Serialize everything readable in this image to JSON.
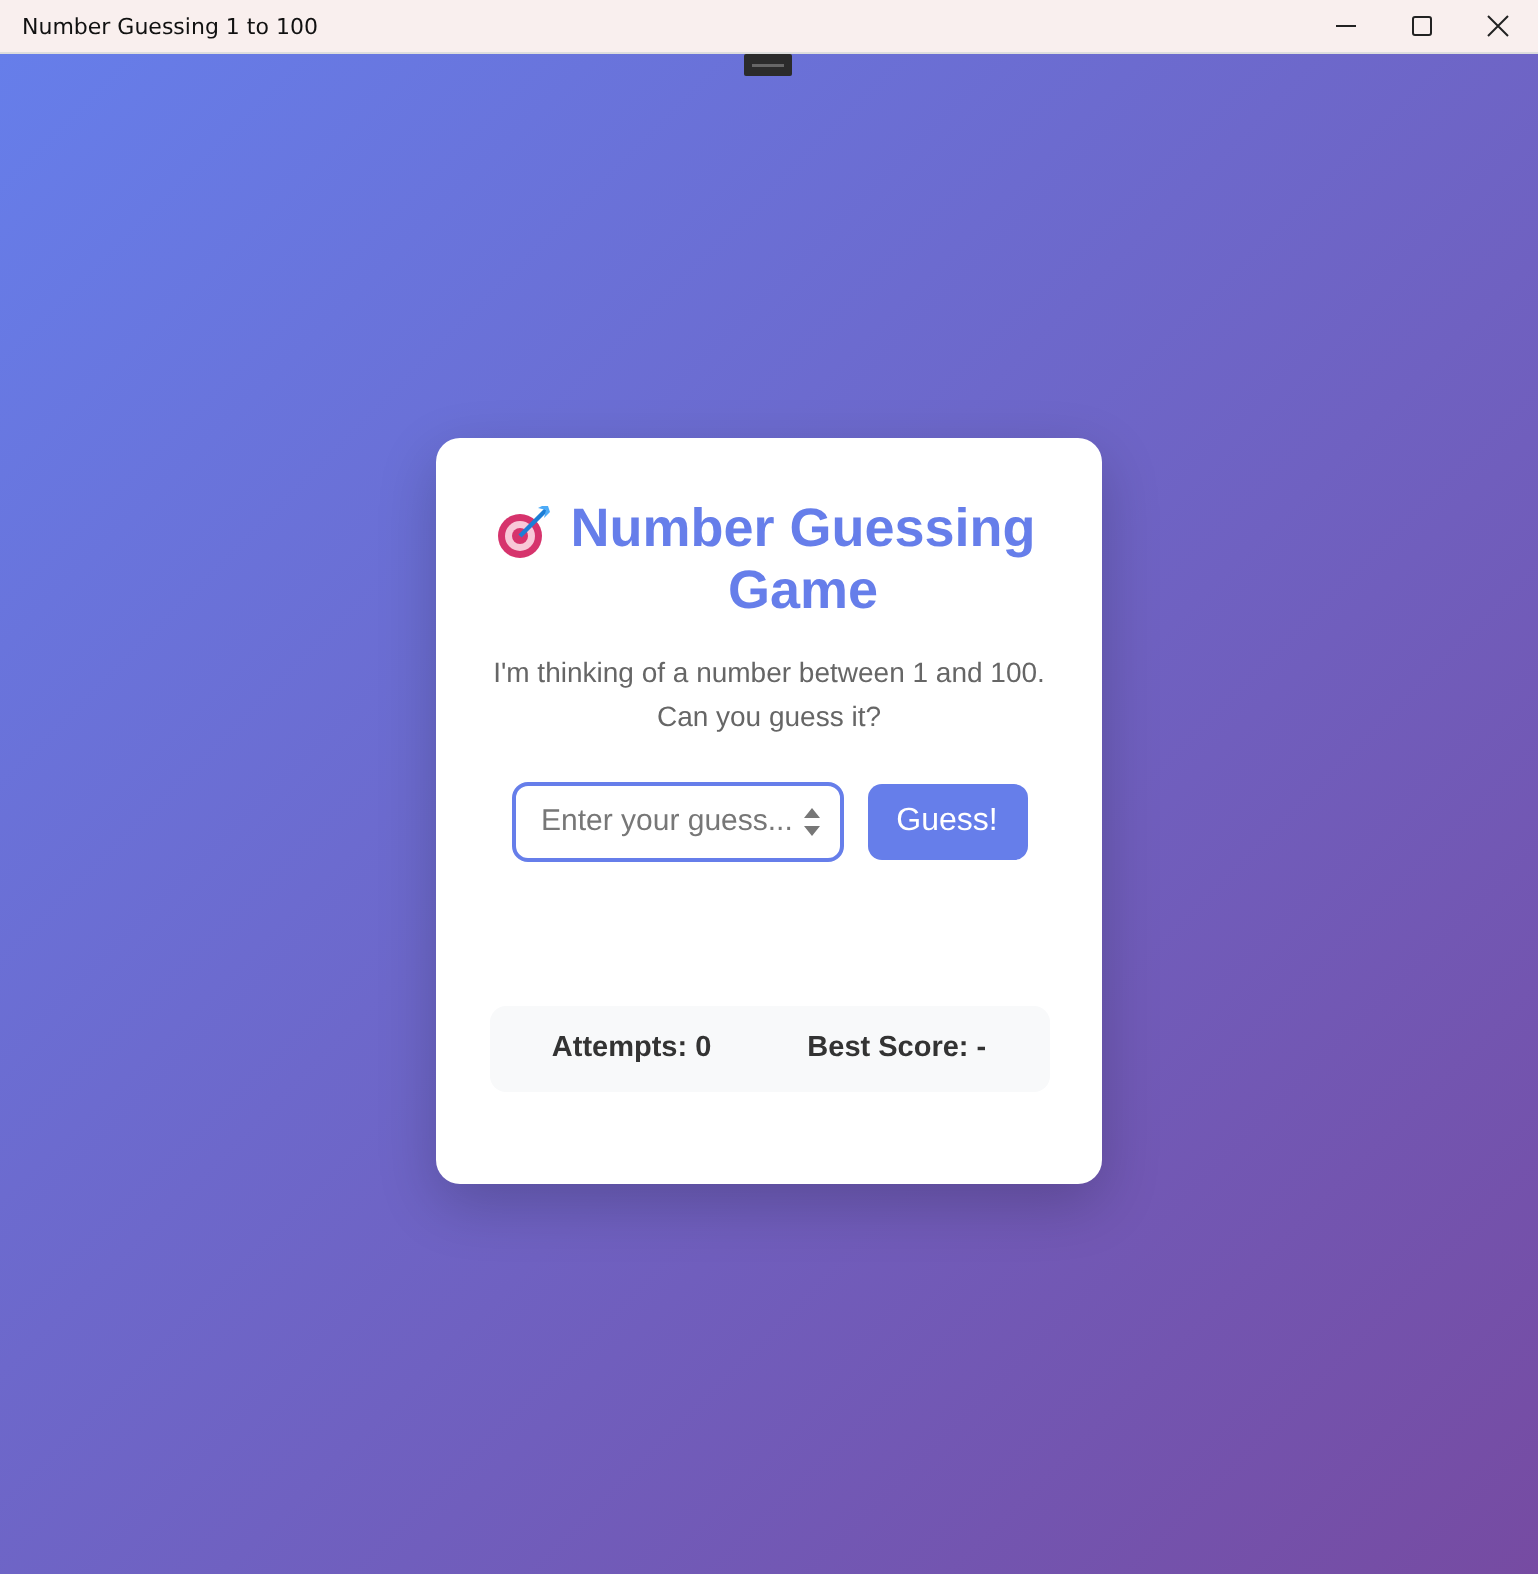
{
  "window": {
    "title": "Number Guessing 1 to 100"
  },
  "game": {
    "title": "Number Guessing Game",
    "description": "I'm thinking of a number between 1 and 100. Can you guess it?",
    "guess_field": {
      "placeholder": "Enter your guess..."
    },
    "guess_button": "Guess!"
  },
  "stats": [
    {
      "text": "Attempts: 0"
    },
    {
      "text": "Best Score: -"
    }
  ]
}
